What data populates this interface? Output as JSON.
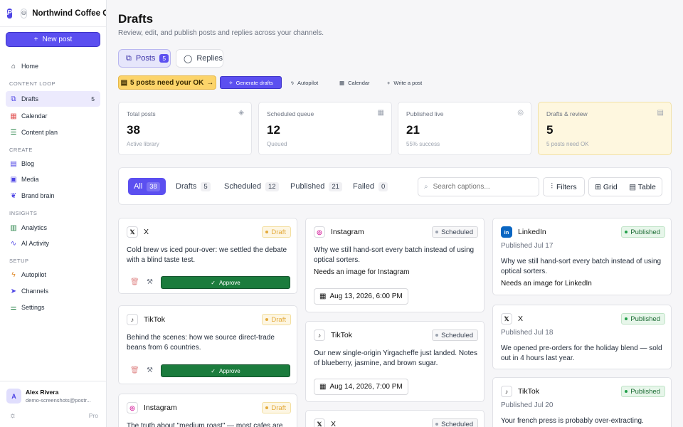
{
  "brand": {
    "name": "Northwind Coffee Co",
    "logo": "P",
    "icon": "link-icon"
  },
  "sidebar": {
    "new_post": "New post",
    "home": "Home",
    "sec_content": "CONTENT LOOP",
    "drafts": "Drafts",
    "drafts_count": "5",
    "calendar": "Calendar",
    "content_plan": "Content plan",
    "sec_create": "CREATE",
    "blog": "Blog",
    "media": "Media",
    "brand_brain": "Brand brain",
    "sec_insights": "INSIGHTS",
    "analytics": "Analytics",
    "ai_activity": "AI Activity",
    "sec_setup": "SETUP",
    "autopilot": "Autopilot",
    "channels": "Channels",
    "settings": "Settings"
  },
  "user": {
    "initial": "A",
    "name": "Alex Rivera",
    "email": "demo-screenshots@postr...",
    "plan": "Pro"
  },
  "header": {
    "title": "Drafts",
    "subtitle": "Review, edit, and publish posts and replies across your channels."
  },
  "segments": {
    "posts": "Posts",
    "posts_count": "5",
    "replies": "Replies"
  },
  "toolbar": {
    "need_ok": "5 posts need your OK",
    "generate": "Generate drafts",
    "autopilot": "Autopilot",
    "calendar": "Calendar",
    "write": "Write a post"
  },
  "stats": [
    {
      "label": "Total posts",
      "value": "38",
      "sub": "Active library"
    },
    {
      "label": "Scheduled queue",
      "value": "12",
      "sub": "Queued"
    },
    {
      "label": "Published live",
      "value": "21",
      "sub": "55% success"
    },
    {
      "label": "Drafts & review",
      "value": "5",
      "sub": "5 posts need OK"
    }
  ],
  "filters": {
    "tabs": [
      {
        "label": "All",
        "count": "38"
      },
      {
        "label": "Drafts",
        "count": "5"
      },
      {
        "label": "Scheduled",
        "count": "12"
      },
      {
        "label": "Published",
        "count": "21"
      },
      {
        "label": "Failed",
        "count": "0"
      }
    ],
    "search_placeholder": "Search captions...",
    "filters_label": "Filters",
    "grid": "Grid",
    "table": "Table"
  },
  "posts": {
    "c1": {
      "platform": "X",
      "status": "Draft",
      "caption": "Cold brew vs iced pour-over: we settled the debate with a blind taste test.",
      "approve": "Approve"
    },
    "c2": {
      "platform": "TikTok",
      "status": "Draft",
      "caption": "Behind the scenes: how we source direct-trade beans from 6 countries.",
      "approve": "Approve"
    },
    "c3": {
      "platform": "Instagram",
      "status": "Draft",
      "caption": "The truth about \"medium roast\" — most cafes are"
    },
    "c4": {
      "platform": "Instagram",
      "status": "Scheduled",
      "caption": "Why we still hand-sort every batch instead of using optical sorters.",
      "need": "Needs an image for Instagram",
      "date": "Aug 13, 2026, 6:00 PM"
    },
    "c5": {
      "platform": "TikTok",
      "status": "Scheduled",
      "caption": "Our new single-origin Yirgacheffe just landed. Notes of blueberry, jasmine, and brown sugar.",
      "date": "Aug 14, 2026, 7:00 PM"
    },
    "c6": {
      "platform": "X",
      "status": "Scheduled"
    },
    "c7": {
      "platform": "LinkedIn",
      "status": "Published",
      "date": "Published Jul 17",
      "caption": "Why we still hand-sort every batch instead of using optical sorters.",
      "need": "Needs an image for LinkedIn"
    },
    "c8": {
      "platform": "X",
      "status": "Published",
      "date": "Published Jul 18",
      "caption": "We opened pre-orders for the holiday blend — sold out in 4 hours last year."
    },
    "c9": {
      "platform": "TikTok",
      "status": "Published",
      "date": "Published Jul 20",
      "caption": "Your french press is probably over-extracting."
    }
  }
}
